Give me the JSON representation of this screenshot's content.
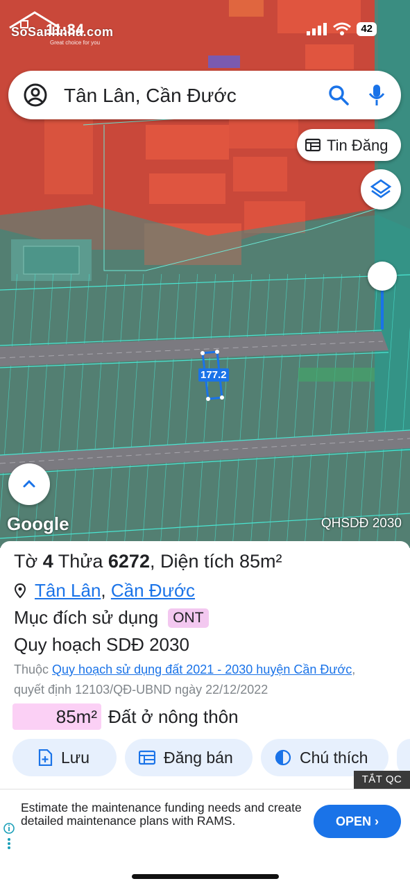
{
  "status": {
    "time": "11:34",
    "battery": "42"
  },
  "watermark": {
    "brand": "SoSanhnha.com",
    "tagline": "Great choice for you"
  },
  "search": {
    "text": "Tân Lân, Cần Đước"
  },
  "map": {
    "tin_dang_label": "Tin Đăng",
    "parcel_label": "177.2",
    "google_label": "Google",
    "plan_label": "QHSDĐ 2030"
  },
  "panel": {
    "title_prefix": "Tờ",
    "sheet": "4",
    "parcel_word": "Thửa",
    "parcel": "6272",
    "area_text": ", Diện tích 85m²",
    "location": {
      "commune": "Tân Lân",
      "separator": ",",
      "district": "Cần Đước"
    },
    "purpose_label": "Mục đích sử dụng",
    "purpose_code": "ONT",
    "plan_title": "Quy hoạch SDĐ 2030",
    "desc_prefix": "Thuộc",
    "desc_link": "Quy hoạch sử dụng đất 2021 - 2030 huyện Cần Đước",
    "desc_suffix": ", quyết định 12103/QĐ-UBND ngày 22/12/2022",
    "area_value": "85m²",
    "area_name": "Đất ở nông thôn",
    "actions": [
      "Lưu",
      "Đăng bán",
      "Chú thích"
    ]
  },
  "ad": {
    "close_label": "TẮT QC",
    "text": "Estimate the maintenance funding needs and create detailed maintenance plans with RAMS.",
    "cta": "OPEN ›"
  },
  "colors": {
    "accent": "#1a73e8",
    "land_residential": "#fbd0f5",
    "plan_overlay_red": "#e4513e",
    "plan_overlay_teal": "#3fd3b8"
  }
}
